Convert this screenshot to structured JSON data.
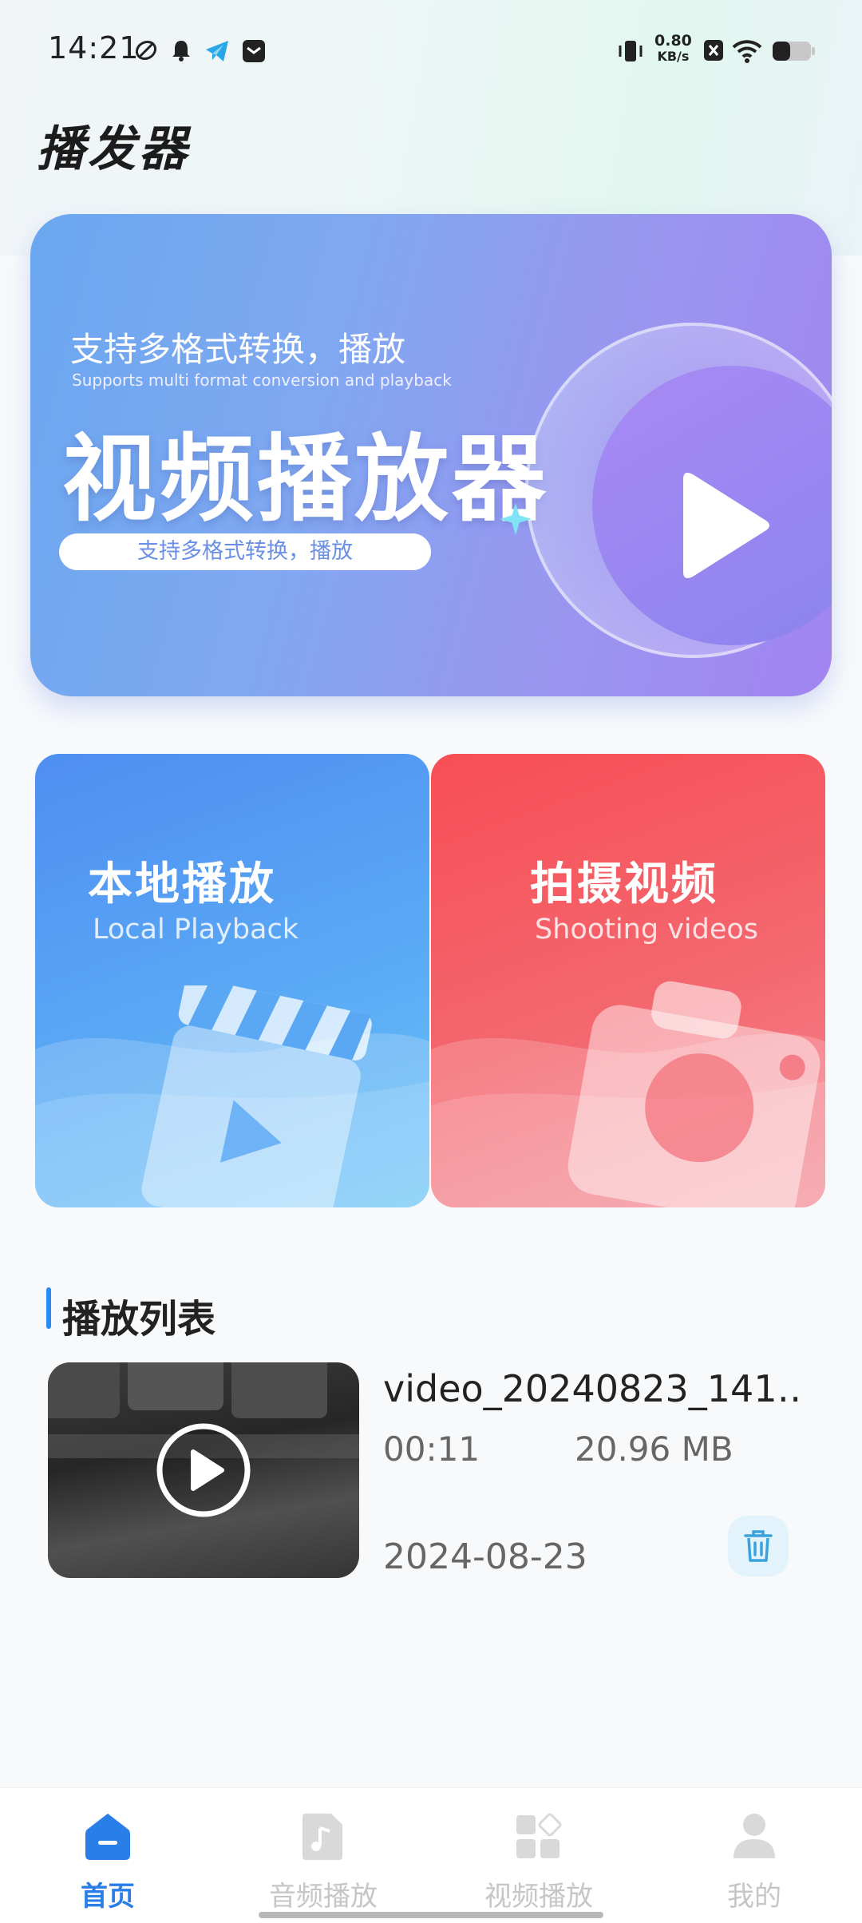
{
  "status_bar": {
    "time": "14:21",
    "speed_value": "0.80",
    "speed_unit": "KB/s"
  },
  "app": {
    "title": "播发器"
  },
  "banner": {
    "subtitle": "支持多格式转换，播放",
    "subtitle_en": "Supports multi format conversion and playback",
    "title": "视频播放器",
    "pill": "支持多格式转换，播放"
  },
  "cards": {
    "local": {
      "title": "本地播放",
      "subtitle": "Local Playback"
    },
    "shoot": {
      "title": "拍摄视频",
      "subtitle": "Shooting videos"
    }
  },
  "playlist": {
    "title": "播放列表",
    "items": [
      {
        "name": "video_20240823_141…",
        "duration": "00:11",
        "size": "20.96 MB",
        "date": "2024-08-23"
      }
    ]
  },
  "nav": {
    "items": [
      {
        "label": "首页",
        "icon": "home-icon",
        "active": true
      },
      {
        "label": "音频播放",
        "icon": "music-file-icon",
        "active": false
      },
      {
        "label": "视频播放",
        "icon": "grid-apps-icon",
        "active": false
      },
      {
        "label": "我的",
        "icon": "user-icon",
        "active": false
      }
    ]
  },
  "colors": {
    "accent": "#2a7ee8",
    "local_card": "#4e8ef2",
    "shoot_card": "#f74e55",
    "banner_start": "#6aa7ef",
    "banner_end": "#a184f0"
  }
}
